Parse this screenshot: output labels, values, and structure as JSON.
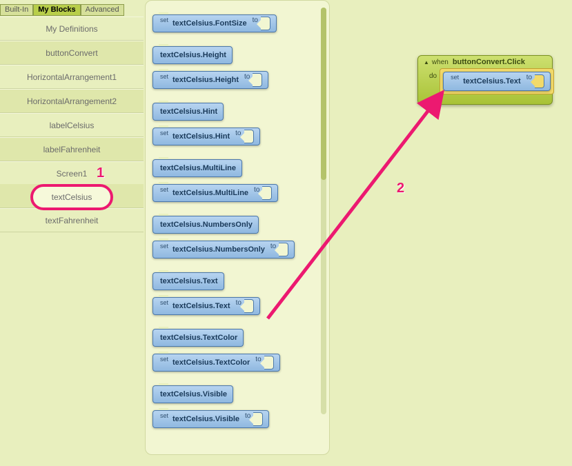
{
  "tabs": {
    "builtin": "Built-In",
    "myblocks": "My Blocks",
    "advanced": "Advanced"
  },
  "components": [
    "My Definitions",
    "buttonConvert",
    "HorizontalArrangement1",
    "HorizontalArrangement2",
    "labelCelsius",
    "labelFahrenheit",
    "Screen1",
    "textCelsius",
    "textFahrenheit"
  ],
  "selected_component_index": 7,
  "kw": {
    "set": "set",
    "to": "to",
    "when": "when",
    "do": "do"
  },
  "drawer_pairs": [
    {
      "get": "textCelsius.FontSize",
      "set": "textCelsius.FontSize",
      "lead": "set_only"
    },
    {
      "get": "textCelsius.Height",
      "set": "textCelsius.Height"
    },
    {
      "get": "textCelsius.Hint",
      "set": "textCelsius.Hint"
    },
    {
      "get": "textCelsius.MultiLine",
      "set": "textCelsius.MultiLine"
    },
    {
      "get": "textCelsius.NumbersOnly",
      "set": "textCelsius.NumbersOnly"
    },
    {
      "get": "textCelsius.Text",
      "set": "textCelsius.Text"
    },
    {
      "get": "textCelsius.TextColor",
      "set": "textCelsius.TextColor"
    },
    {
      "get": "textCelsius.Visible",
      "set": "textCelsius.Visible"
    }
  ],
  "canvas_event": {
    "label": "buttonConvert.Click",
    "child_set": "textCelsius.Text"
  },
  "callouts": {
    "one": "1",
    "two": "2"
  },
  "colors": {
    "accent": "#ec1970"
  }
}
